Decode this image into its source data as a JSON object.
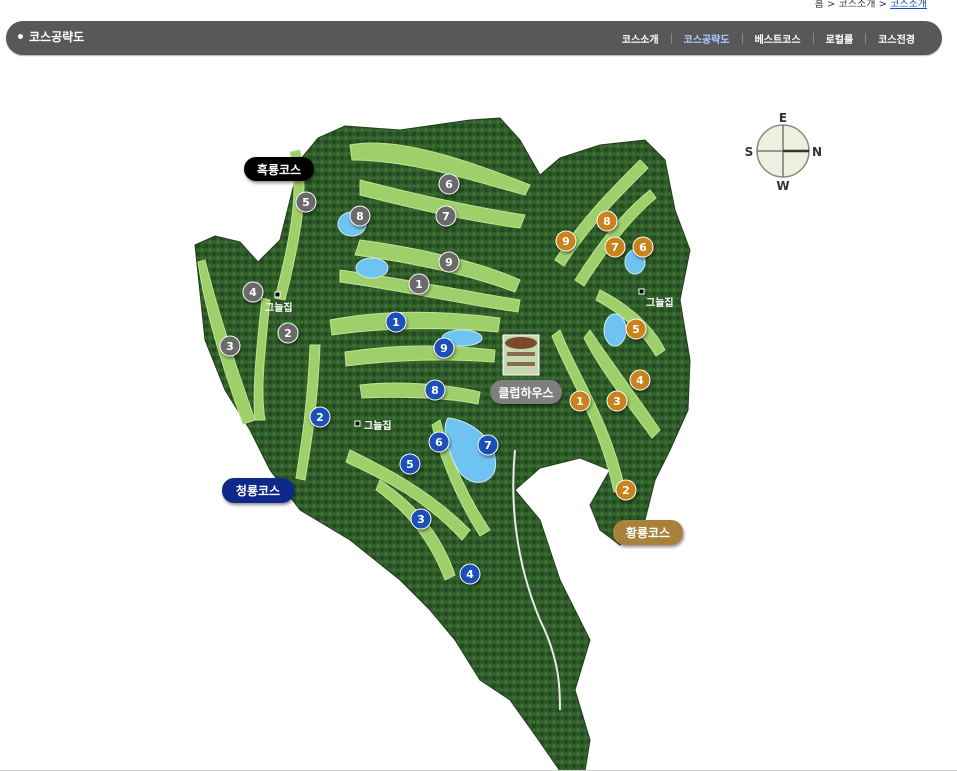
{
  "breadcrumb": {
    "home": "홈",
    "sep1": ">",
    "level1": "코스소개",
    "sep2": ">",
    "current": "코스소개"
  },
  "header": {
    "title": "코스공략도",
    "menu": [
      "코스소개",
      "코스공략도",
      "베스트코스",
      "로컬룰",
      "코스전경"
    ],
    "active_index": 1
  },
  "compass": {
    "top": "E",
    "left": "S",
    "right": "N",
    "bottom": "W"
  },
  "courses": {
    "black": {
      "name": "흑룡코스",
      "color": "#000000"
    },
    "blue": {
      "name": "청룡코스",
      "color": "#0a2a8a"
    },
    "gold": {
      "name": "황룡코스",
      "color": "#a8813a"
    }
  },
  "clubhouse": "클럽하우스",
  "shelters": [
    "그늘집",
    "그늘집",
    "그늘집"
  ],
  "holes": {
    "black": [
      "1",
      "2",
      "3",
      "4",
      "5",
      "6",
      "7",
      "8",
      "9"
    ],
    "blue": [
      "1",
      "2",
      "3",
      "4",
      "5",
      "6",
      "7",
      "8",
      "9"
    ],
    "gold": [
      "1",
      "2",
      "3",
      "4",
      "5",
      "6",
      "7",
      "8",
      "9"
    ]
  },
  "colors": {
    "bar": "#58585a",
    "active_menu": "#aecbff",
    "hole_black": "#6a6a6a",
    "hole_blue": "#1d4fb8",
    "hole_gold": "#c9831c",
    "forest": "#2e5b2a",
    "fairway": "#9fcf6a",
    "water": "#6ec3f0"
  }
}
